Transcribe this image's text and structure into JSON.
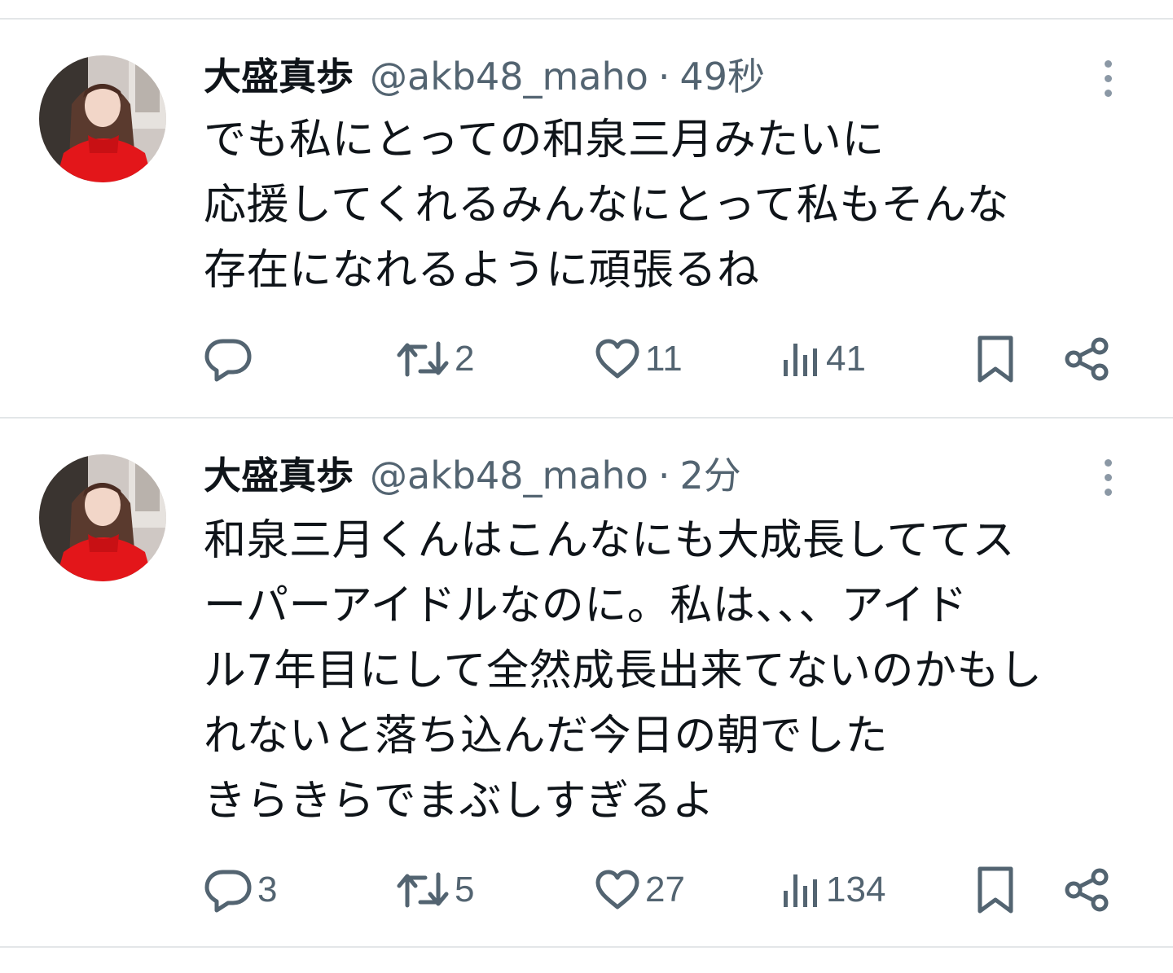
{
  "tweets": [
    {
      "author": {
        "name": "大盛真歩",
        "handle": "@akb48_maho"
      },
      "separator": "·",
      "time": "49秒",
      "lines": [
        "でも私にとっての和泉三月みたいに",
        "応援してくれるみんなにとって私もそんな",
        "存在になれるように頑張るね"
      ],
      "stats": {
        "replies": "",
        "retweets": "2",
        "likes": "11",
        "views": "41"
      }
    },
    {
      "author": {
        "name": "大盛真歩",
        "handle": "@akb48_maho"
      },
      "separator": "·",
      "time": "2分",
      "lines": [
        "和泉三月くんはこんなにも大成長しててス",
        "ーパーアイドルなのに。私は、、、アイド",
        "ル7年目にして全然成長出来てないのかもし",
        "れないと落ち込んだ今日の朝でした",
        "きらきらでまぶしすぎるよ"
      ],
      "stats": {
        "replies": "3",
        "retweets": "5",
        "likes": "27",
        "views": "134"
      }
    }
  ],
  "icons": {
    "reply": "reply-bubble-icon",
    "retweet": "retweet-arrows-icon",
    "like": "heart-icon",
    "views": "bar-chart-icon",
    "bookmark": "bookmark-icon",
    "share": "share-icon",
    "more": "vertical-ellipsis-icon"
  },
  "colors": {
    "text": "#0f1419",
    "secondary": "#536471",
    "divider": "#e3e6e8",
    "avatar_dress": "#e3161a"
  }
}
